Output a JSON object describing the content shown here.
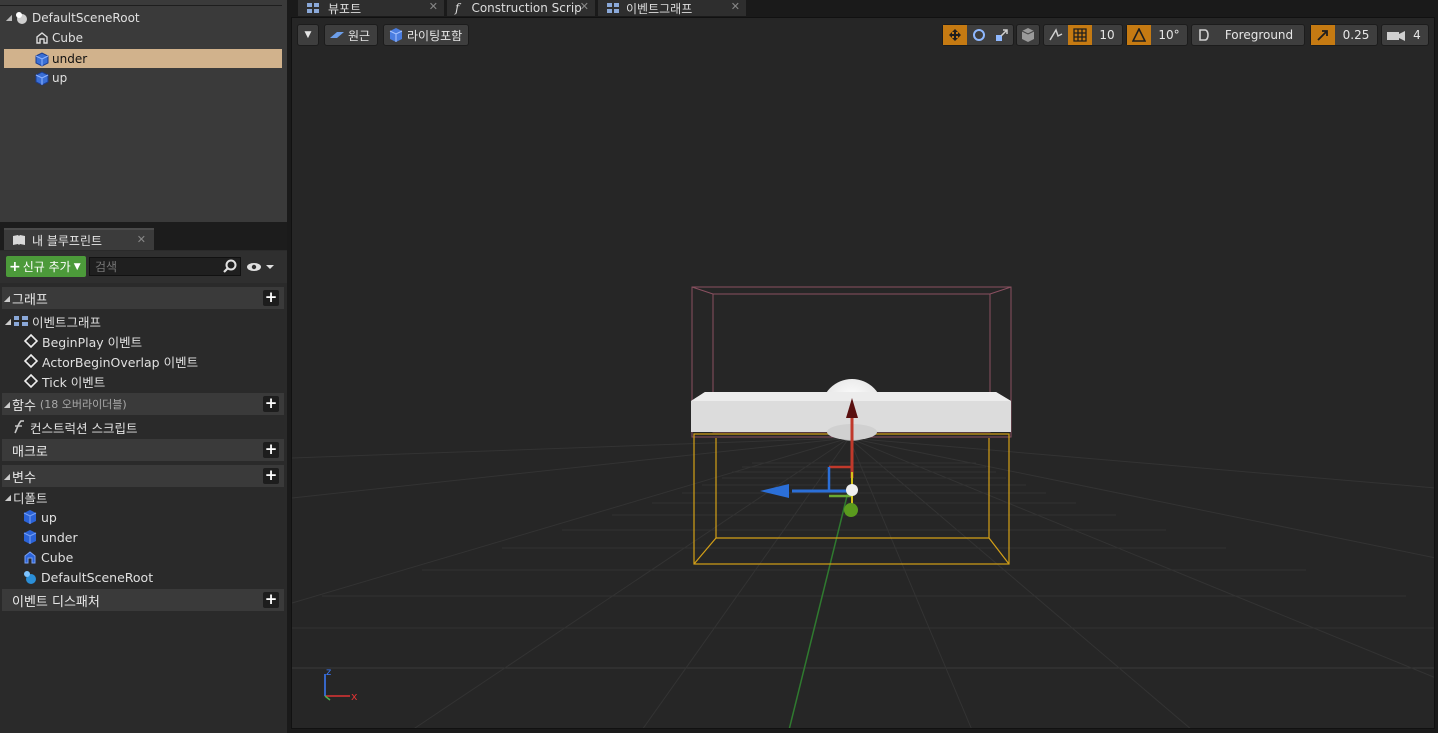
{
  "components": {
    "items": [
      {
        "label": "DefaultSceneRoot",
        "icon": "scene-root-icon",
        "indent": 0,
        "selected": false
      },
      {
        "label": "Cube",
        "icon": "cube-actor-icon",
        "indent": 1,
        "selected": false
      },
      {
        "label": "under",
        "icon": "box-collision-icon",
        "indent": 1,
        "selected": true
      },
      {
        "label": "up",
        "icon": "box-collision-icon",
        "indent": 1,
        "selected": false
      }
    ]
  },
  "my_blueprint": {
    "tab_label": "내 블루프린트",
    "add_new_label": "신규 추가",
    "search_placeholder": "검색",
    "sections": {
      "graph": "그래프",
      "event_graph": "이벤트그래프",
      "events": [
        "BeginPlay 이벤트",
        "ActorBeginOverlap 이벤트",
        "Tick 이벤트"
      ],
      "functions": "함수",
      "functions_sub": "(18 오버라이더블)",
      "construction_script": "컨스트럭션 스크립트",
      "macros": "매크로",
      "variables": "변수",
      "default": "디폴트",
      "variables_list": [
        "up",
        "under",
        "Cube",
        "DefaultSceneRoot"
      ],
      "event_dispatchers": "이벤트 디스패처"
    }
  },
  "viewport_tabs": [
    "뷰포트",
    "Construction Scrip",
    "이벤트그래프"
  ],
  "viewport": {
    "perspective_label": "원근",
    "lighting_label": "라이팅포함",
    "grid_snap": "10",
    "rotation_snap": "10°",
    "layer_label": "Foreground",
    "scale_snap": "0.25",
    "camera_speed": "4",
    "axis_x": "x",
    "axis_z": "z"
  },
  "colors": {
    "selected_row": "#d1b28c",
    "add_new": "#4c9a3a",
    "snap_active": "#c57a12",
    "bounds_orange": "#d4a017",
    "bounds_pink": "#8a5060"
  }
}
